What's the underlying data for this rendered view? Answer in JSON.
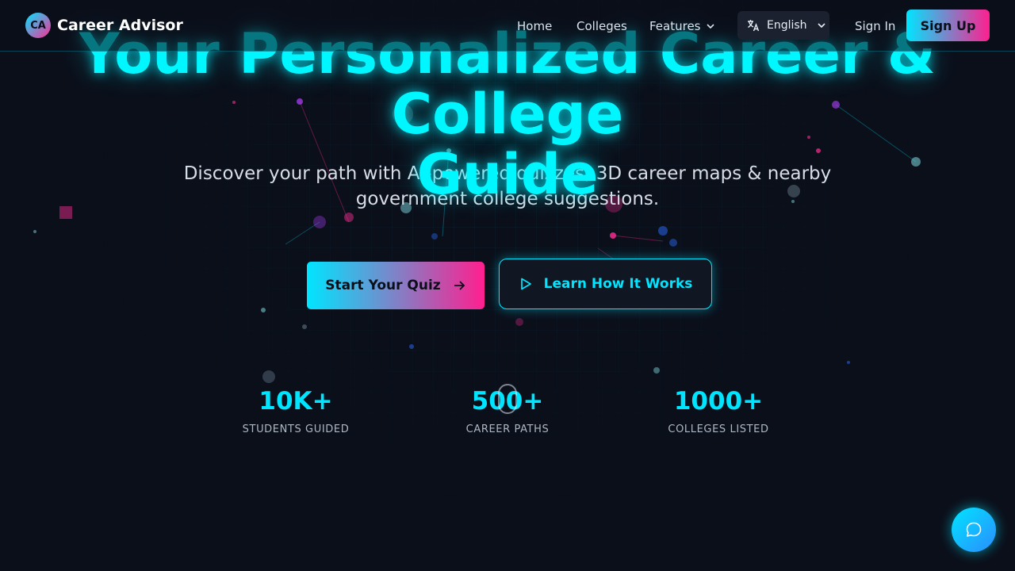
{
  "nav": {
    "logo_badge": "CA",
    "brand": "Career Advisor",
    "links": {
      "home": "Home",
      "colleges": "Colleges",
      "features": "Features"
    },
    "language": "English",
    "sign_in": "Sign In",
    "sign_up": "Sign Up"
  },
  "hero": {
    "title_line1": "Your Personalized Career & College",
    "title_line2": "Guide",
    "subtitle": "Discover your path with AI-powered quizzes, 3D career maps & nearby government college suggestions.",
    "primary_button": "Start Your Quiz",
    "secondary_button": "Learn How It Works"
  },
  "stats": [
    {
      "value": "10K+",
      "label": "STUDENTS GUIDED"
    },
    {
      "value": "500+",
      "label": "CAREER PATHS"
    },
    {
      "value": "1000+",
      "label": "COLLEGES LISTED"
    }
  ],
  "colors": {
    "background": "#0b0f1a",
    "accent_cyan": "#00e5ff",
    "accent_pink": "#ff1f8f"
  },
  "icons": {
    "translate": "translate-icon",
    "chevron": "chevron-down-icon",
    "arrow": "arrow-right-icon",
    "play": "play-icon",
    "chat": "chat-bubble-icon"
  }
}
